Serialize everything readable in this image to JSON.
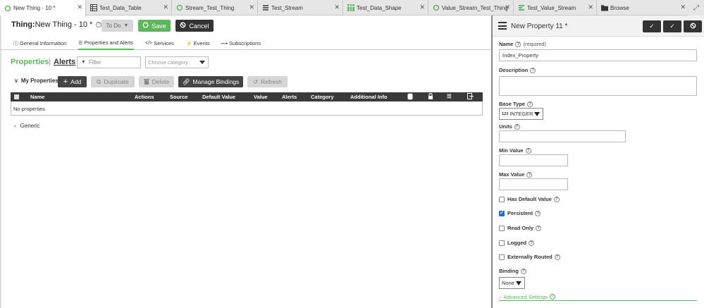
{
  "tabs": [
    {
      "label": "New Thing - 10 *",
      "icon": "thing-icon",
      "active": true
    },
    {
      "label": "Test_Data_Table",
      "icon": "table-icon",
      "active": false
    },
    {
      "label": "Stream_Test_Thing",
      "icon": "thing-icon",
      "active": false
    },
    {
      "label": "Test_Stream",
      "icon": "stream-icon",
      "active": false
    },
    {
      "label": "Test_Data_Shape",
      "icon": "datashape-icon",
      "active": false
    },
    {
      "label": "Value_Stream_Test_Thing",
      "icon": "thing-icon",
      "active": false
    },
    {
      "label": "Test_Value_Stream",
      "icon": "valuestream-icon",
      "active": false
    },
    {
      "label": "Browse",
      "icon": "folder-icon",
      "active": false
    }
  ],
  "header": {
    "thing_prefix": "Thing:",
    "thing_name": "New Thing - 10 *",
    "todo_label": "To Do",
    "save_label": "Save",
    "cancel_label": "Cancel"
  },
  "subtabs": [
    {
      "label": "General Information",
      "icon": "info-icon"
    },
    {
      "label": "Properties and Alerts",
      "icon": "list-icon"
    },
    {
      "label": "Services",
      "icon": "code-icon"
    },
    {
      "label": "Events",
      "icon": "bolt-icon"
    },
    {
      "label": "Subscriptions",
      "icon": "subscription-icon"
    }
  ],
  "properties_section": {
    "properties_label": "Properties",
    "separator": "|",
    "alerts_label": "Alerts",
    "filter_placeholder": "Filter",
    "category_placeholder": "Choose category"
  },
  "toolbar": {
    "section_label": "My Properties",
    "add_label": "Add",
    "duplicate_label": "Duplicate",
    "delete_label": "Delete",
    "manage_bindings_label": "Manage Bindings",
    "refresh_label": "Refresh"
  },
  "grid": {
    "columns": [
      "Name",
      "Actions",
      "Source",
      "Default Value",
      "Value",
      "Alerts",
      "Category",
      "Additional Info"
    ],
    "empty_text": "No properties"
  },
  "generic_label": "Generic",
  "right_panel": {
    "title": "New Property 11 *",
    "name_label": "Name",
    "name_required": "(required)",
    "name_value": "Index_Property",
    "description_label": "Description",
    "description_value": "",
    "base_type_label": "Base Type",
    "base_type_prefix": "123",
    "base_type_value": "INTEGER",
    "units_label": "Units",
    "min_label": "Min Value",
    "max_label": "Max Value",
    "checkboxes": [
      {
        "label": "Has Default Value",
        "checked": false
      },
      {
        "label": "Persistent",
        "checked": true
      },
      {
        "label": "Read Only",
        "checked": false
      },
      {
        "label": "Logged",
        "checked": false
      },
      {
        "label": "Externally Routed",
        "checked": false
      }
    ],
    "binding_label": "Binding",
    "binding_value": "None",
    "advanced_label": "Advanced Settings"
  }
}
